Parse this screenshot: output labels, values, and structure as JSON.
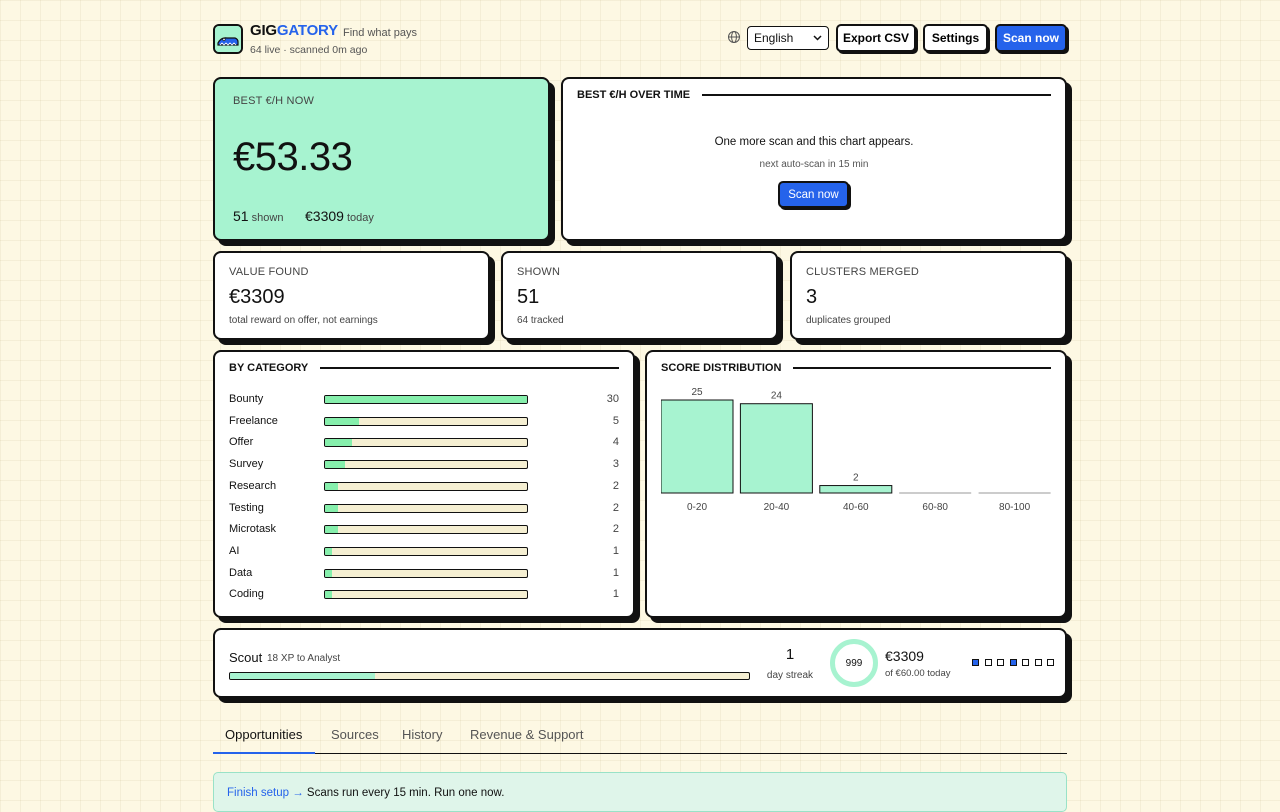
{
  "header": {
    "brand_part1": "GIG",
    "brand_part2": "GATORY",
    "tagline": "Find what pays",
    "status": "64 live · scanned 0m ago",
    "language": "English",
    "export_label": "Export CSV",
    "settings_label": "Settings",
    "scan_label": "Scan now"
  },
  "hero": {
    "kicker": "BEST €/H NOW",
    "value": "€53.33",
    "shown_num": "51",
    "shown_label": "shown",
    "today_num": "€3309",
    "today_label": "today"
  },
  "over_time": {
    "title": "BEST €/H OVER TIME",
    "message": "One more scan and this chart appears.",
    "next_scan": "next auto-scan in 15 min",
    "scan_label": "Scan now"
  },
  "stats": [
    {
      "kicker": "VALUE FOUND",
      "value": "€3309",
      "sub": "total reward on offer, not earnings"
    },
    {
      "kicker": "SHOWN",
      "value": "51",
      "sub": "64 tracked"
    },
    {
      "kicker": "CLUSTERS MERGED",
      "value": "3",
      "sub": "duplicates grouped"
    }
  ],
  "category": {
    "title": "BY CATEGORY",
    "max": 30,
    "items": [
      {
        "name": "Bounty",
        "count": 30
      },
      {
        "name": "Freelance",
        "count": 5
      },
      {
        "name": "Offer",
        "count": 4
      },
      {
        "name": "Survey",
        "count": 3
      },
      {
        "name": "Research",
        "count": 2
      },
      {
        "name": "Testing",
        "count": 2
      },
      {
        "name": "Microtask",
        "count": 2
      },
      {
        "name": "AI",
        "count": 1
      },
      {
        "name": "Data",
        "count": 1
      },
      {
        "name": "Coding",
        "count": 1
      }
    ]
  },
  "chart_data": {
    "type": "bar",
    "title": "SCORE DISTRIBUTION",
    "categories": [
      "0-20",
      "20-40",
      "40-60",
      "60-80",
      "80-100"
    ],
    "values": [
      25,
      24,
      2,
      0,
      0
    ],
    "ylim": [
      0,
      25
    ]
  },
  "level": {
    "rank": "Scout",
    "xp_text": "18 XP to Analyst",
    "progress": 0.28,
    "streak_num": "1",
    "streak_label": "day streak",
    "ring_value": "999",
    "earn_value": "€3309",
    "earn_sub": "of €60.00 today",
    "squares": [
      true,
      false,
      false,
      true,
      false,
      false,
      false
    ]
  },
  "tabs": [
    "Opportunities",
    "Sources",
    "History",
    "Revenue & Support"
  ],
  "setup": {
    "link": "Finish setup →",
    "text": " Scans run every 15 min. Run one now."
  },
  "colors": {
    "accent": "#2563eb",
    "mint": "#a7f3d0",
    "background": "#fdf8e3"
  }
}
